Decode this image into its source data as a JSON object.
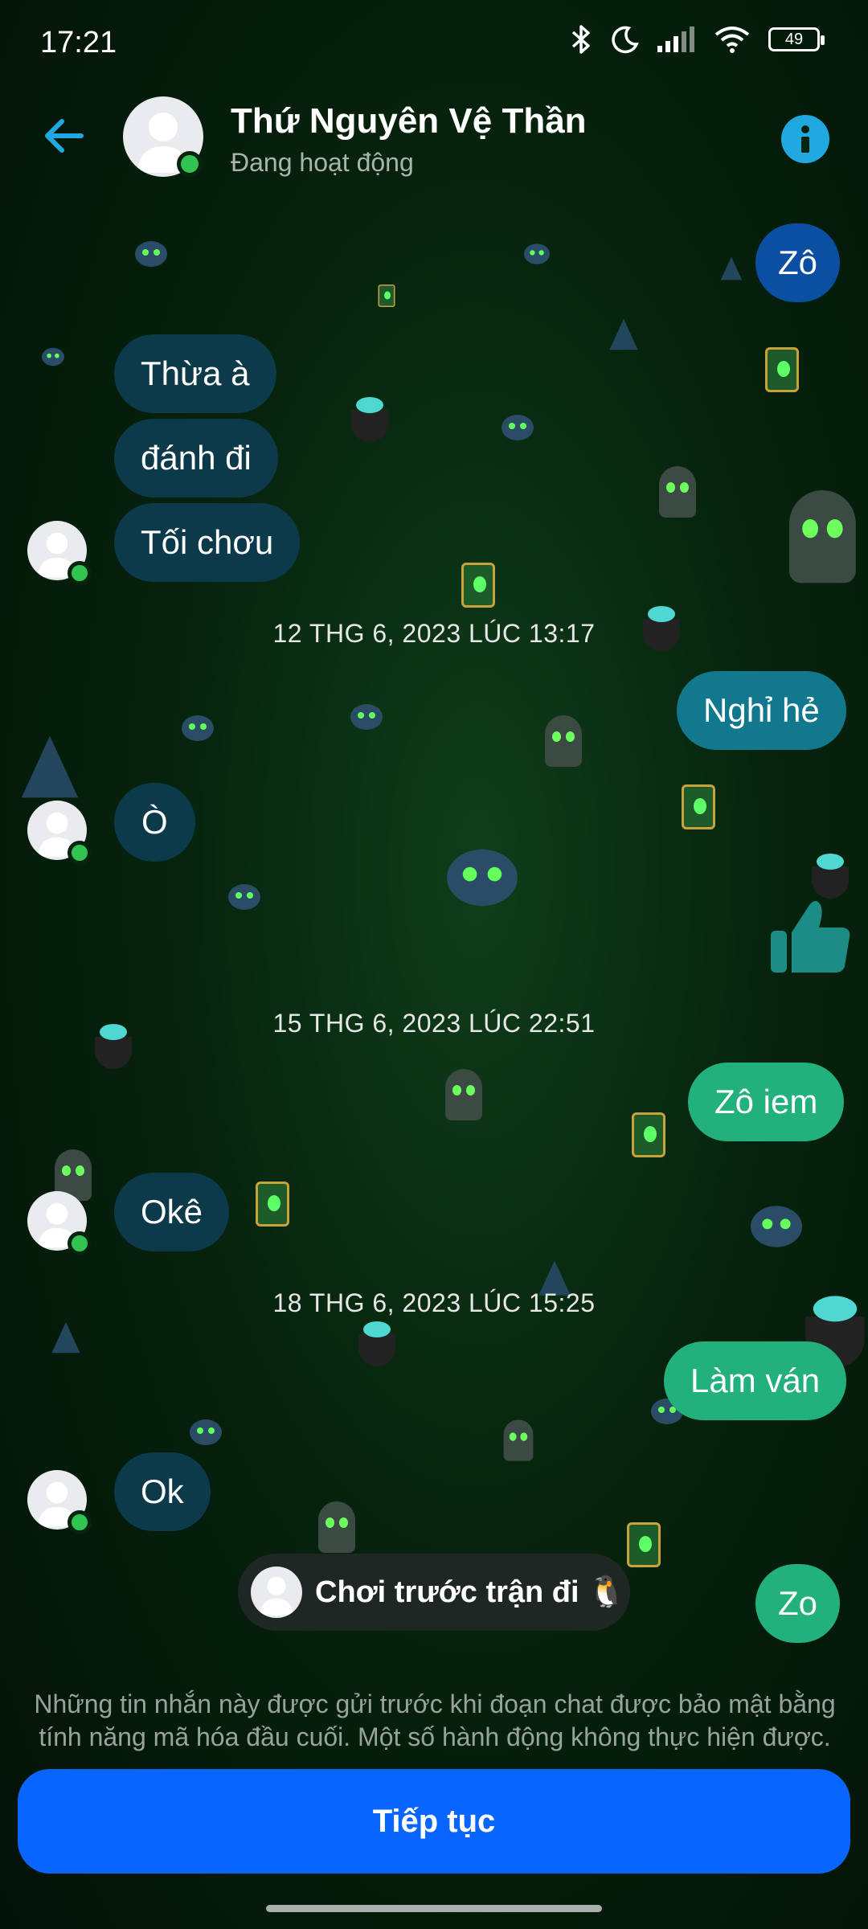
{
  "status_bar": {
    "time": "17:21",
    "battery": "49"
  },
  "header": {
    "name": "Thứ Nguyên Vệ Thần",
    "status": "Đang hoạt động"
  },
  "messages": {
    "m1": "Zô",
    "m2": "Thừa à",
    "m3": "đánh đi",
    "m4": "Tối chơu",
    "ts1": "12 THG 6, 2023 LÚC 13:17",
    "m5": "Nghỉ hẻ",
    "m6": "Ò",
    "ts2": "15 THG 6, 2023 LÚC 22:51",
    "m7": "Zô iem",
    "m8": "Okê",
    "ts3": "18 THG 6, 2023 LÚC 15:25",
    "m9": "Làm ván",
    "m10": "Ok",
    "m11": "Zo"
  },
  "game_card": {
    "text": "Chơi trước trận đi 🐧"
  },
  "footer": {
    "note": "Những tin nhắn này được gửi trước khi đoạn chat được bảo mật bằng tính năng mã hóa đầu cuối. Một số hành động không thực hiện được.",
    "continue_label": "Tiếp tục"
  },
  "colors": {
    "primary_button": "#0866ff",
    "online": "#31c452",
    "incoming_bubble": "#0c3a4b",
    "info": "#1fa9e0"
  },
  "icons": [
    "back-arrow-icon",
    "info-icon",
    "bluetooth-icon",
    "moon-icon",
    "signal-icon",
    "wifi-icon",
    "battery-icon",
    "like-icon"
  ]
}
